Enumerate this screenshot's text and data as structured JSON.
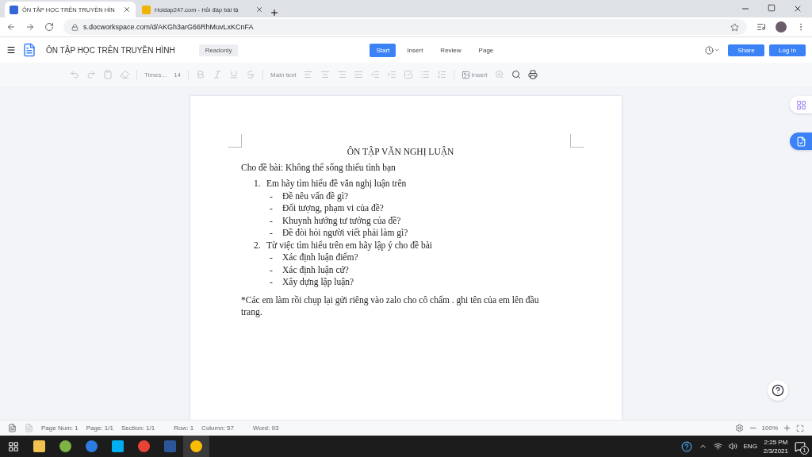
{
  "browser": {
    "tabs": [
      {
        "title": "ÔN TẬP HỌC TRÊN TRUYỀN HÌN",
        "selected": true
      },
      {
        "title": "Hoidap247.com - Hỏi đáp bài tậ",
        "selected": false
      }
    ],
    "url": "s.docworkspace.com/d/AKGh3arG66RhMuvLxKCnFA"
  },
  "app": {
    "doc_title": "ÔN TẬP HỌC TRÊN TRUYỀN HÌNH",
    "badge": "Readonly",
    "menu": [
      {
        "label": "Start",
        "selected": true
      },
      {
        "label": "Insert",
        "selected": false
      },
      {
        "label": "Review",
        "selected": false
      },
      {
        "label": "Page",
        "selected": false
      }
    ],
    "buttons": [
      "Share",
      "Log in"
    ]
  },
  "toolbar": {
    "font": "Times...",
    "size": "14",
    "style": "Main text",
    "insert": "Insert"
  },
  "document": {
    "heading": "ÔN TẬP VĂN NGHỊ LUẬN",
    "intro": "Cho đề bài: Không thể sống thiếu tình bạn",
    "items": [
      {
        "number": "1.",
        "text": "Em hãy tìm hiểu đề văn nghị luận trên",
        "children": [
          {
            "bullet": "-",
            "text": "Đề nêu vấn đề gì?"
          },
          {
            "bullet": "-",
            "text": "Đối tượng, phạm vi của đề?"
          },
          {
            "bullet": "-",
            "text": "Khuynh hướng tư tưởng của đề?"
          },
          {
            "bullet": "-",
            "text": "Đề đòi hỏi người viết phải làm gì?"
          }
        ]
      },
      {
        "number": "2.",
        "text": "Từ việc tìm hiểu trên em hãy lập ý cho đề bài",
        "children": [
          {
            "bullet": "-",
            "text": "Xác định luận điểm?"
          },
          {
            "bullet": "-",
            "text": "Xác định luận cứ?"
          },
          {
            "bullet": "-",
            "text": "Xây dựng lập luận?"
          }
        ]
      }
    ],
    "note": "*Các em làm rồi chụp lại gửi riêng vào zalo cho cô chấm . ghi tên của em lên đầu trang."
  },
  "status_bar": {
    "fields": [
      "Page Num: 1",
      "Page: 1/1",
      "Section: 1/1",
      "Row: 1",
      "Column: 57",
      "Word: 93"
    ],
    "zoom": "100%"
  },
  "taskbar": {
    "language": "ENG",
    "time": "2:25 PM",
    "date": "2/3/2021",
    "notifications": "1"
  }
}
